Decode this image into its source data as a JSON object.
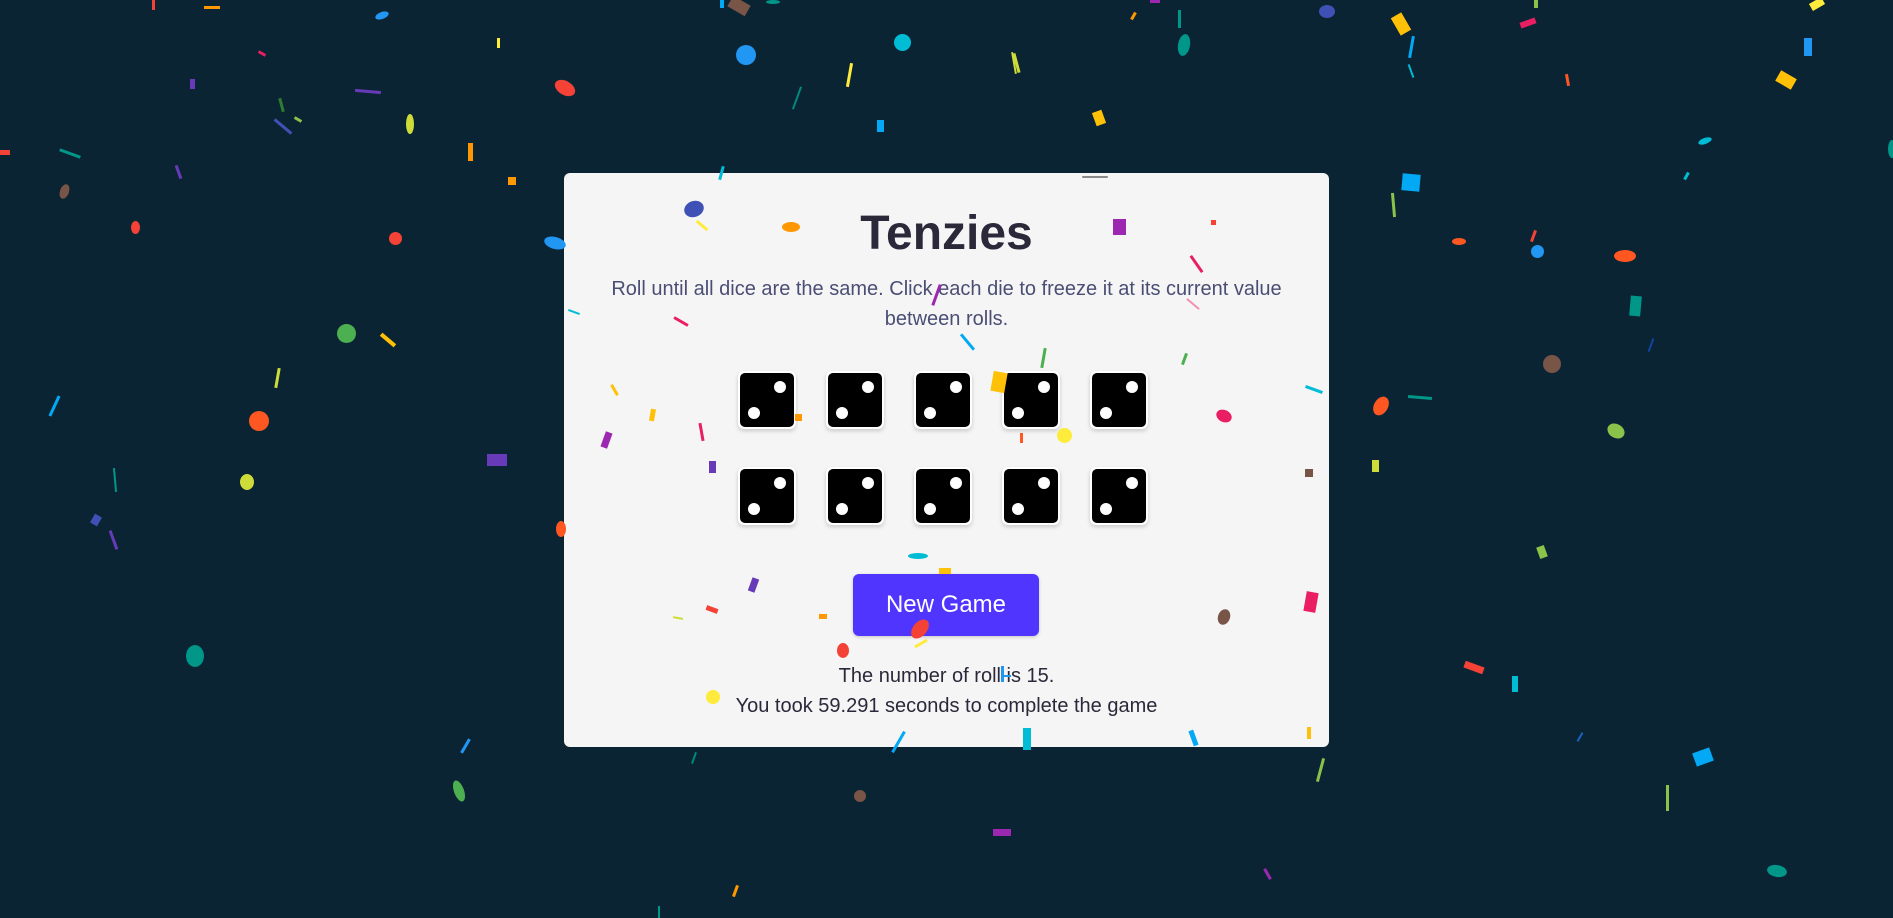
{
  "app": {
    "title": "Tenzies",
    "instructions": "Roll until all dice are the same. Click each die to freeze it at its current value between rolls."
  },
  "dice": [
    {
      "value": 2
    },
    {
      "value": 2
    },
    {
      "value": 2
    },
    {
      "value": 2
    },
    {
      "value": 2
    },
    {
      "value": 2
    },
    {
      "value": 2
    },
    {
      "value": 2
    },
    {
      "value": 2
    },
    {
      "value": 2
    }
  ],
  "controls": {
    "new_game_label": "New Game"
  },
  "results": {
    "rolls_text": "The number of roll is 15.",
    "time_text": "You took 59.291 seconds to complete the game"
  },
  "colors": {
    "background": "#0b2434",
    "card": "#f5f5f5",
    "button": "#5035ff",
    "die_face": "#000000",
    "pip": "#ffffff"
  },
  "effects": {
    "confetti": true,
    "confetti_colors": [
      "#f44336",
      "#e91e63",
      "#9c27b0",
      "#673ab7",
      "#3f51b5",
      "#2196f3",
      "#03a9f4",
      "#00bcd4",
      "#009688",
      "#4caf50",
      "#8bc34a",
      "#cddc39",
      "#ffeb3b",
      "#ffc107",
      "#ff9800",
      "#ff5722",
      "#795548"
    ]
  }
}
